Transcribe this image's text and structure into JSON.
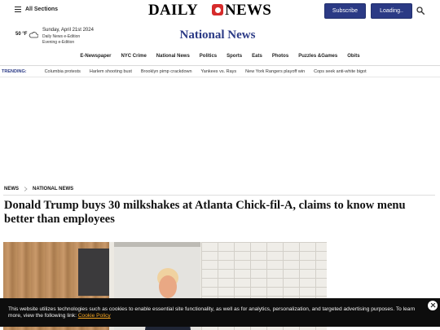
{
  "header": {
    "sections_label": "All Sections",
    "logo_left": "DAILY",
    "logo_right": "NEWS",
    "subscribe_label": "Subscribe",
    "login_label": "Loading..",
    "search_icon": "search-icon"
  },
  "weather": {
    "temperature": "50 °F",
    "icon": "partly-cloudy-icon",
    "date": "Sunday, April 21st 2024",
    "edition": "Daily News e-Edition",
    "evening_edition": "Evening e-Edition"
  },
  "section_title": "National News",
  "nav": {
    "items": [
      "E-Newspaper",
      "NYC Crime",
      "National News",
      "Politics",
      "Sports",
      "Eats",
      "Photos",
      "Puzzles &Games",
      "Obits"
    ]
  },
  "trending": {
    "label": "TRENDING:",
    "items": [
      "Columbia protests",
      "Harlem shooting bust",
      "Brooklyn pimp crackdown",
      "Yankees vs. Rays",
      "New York Rangers playoff win",
      "Cops seek anti-white bigot"
    ]
  },
  "breadcrumb": {
    "items": [
      "NEWS",
      "NATIONAL NEWS"
    ]
  },
  "article": {
    "headline": "Donald Trump buys 30 milkshakes at Atlanta Chick-fil-A, claims to know menu better than employees"
  },
  "cookie": {
    "text": "This website utilizes technologies such as cookies to enable essential site functionality, as well as for analytics, personalization, and targeted advertising purposes. To learn more, view the following link: ",
    "link_label": "Cookie Policy"
  },
  "colors": {
    "brand_blue": "#2b3a85",
    "logo_red": "#d62b2b",
    "cookie_link": "#f5a623"
  }
}
